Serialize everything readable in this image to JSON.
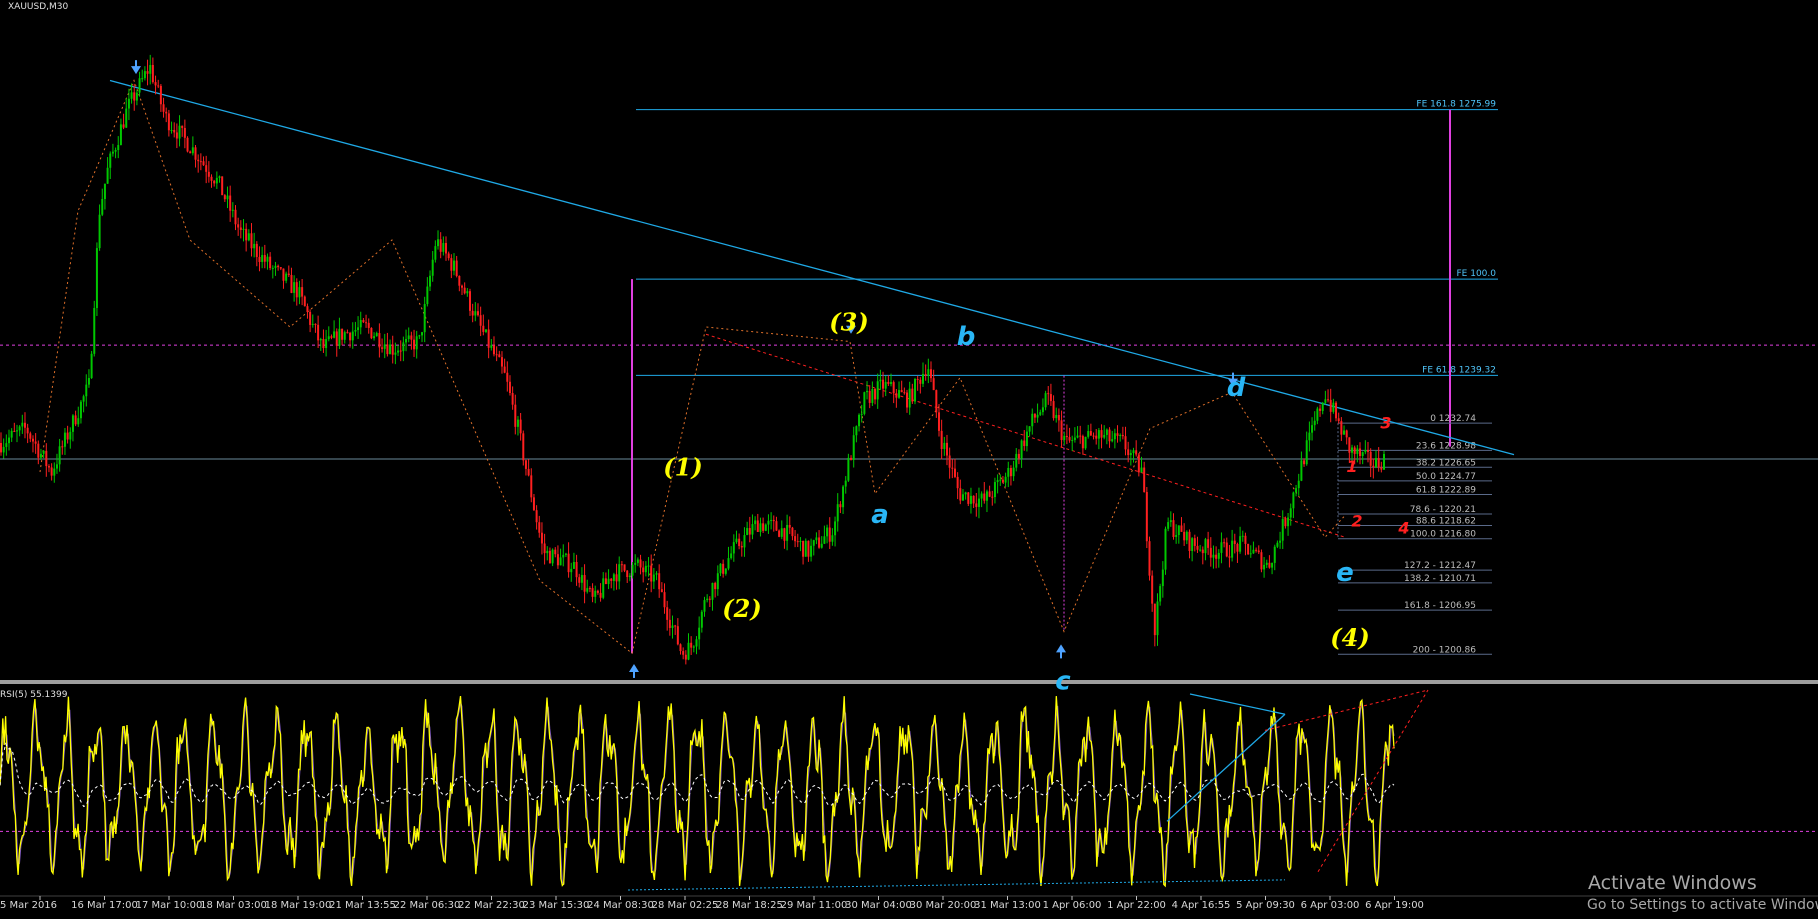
{
  "window": {
    "symbol_label": "XAUUSD,M30",
    "indicator_label": "RSI(5) 55.1399"
  },
  "watermark": {
    "line1": "Activate Windows",
    "line2": "Go to Settings to activate Windows."
  },
  "colors": {
    "background": "#000000",
    "candle_up": "#00c800",
    "candle_down": "#ff2020",
    "trendline": "#1fa9e6",
    "fib_expansion": "#1fa9e6",
    "magenta": "#e040e0",
    "wave_yellow": "#ffff00",
    "wave_blue": "#29b6f6",
    "wave_red": "#ff2020",
    "rsi_main": "#ffff00",
    "rsi_secondary": "#7e57c2",
    "zigzag": "#e0702a"
  },
  "chart_data": [
    {
      "type": "candlestick",
      "title": "",
      "instrument": "XAUUSD",
      "timeframe": "M30",
      "ylim": [
        1198,
        1290
      ],
      "x_tick_labels": [
        "5 Mar 2016",
        "16 Mar 17:00",
        "17 Mar 10:00",
        "18 Mar 03:00",
        "18 Mar 19:00",
        "21 Mar 13:55",
        "22 Mar 06:30",
        "22 Mar 22:30",
        "23 Mar 15:30",
        "24 Mar 08:30",
        "28 Mar 02:25",
        "28 Mar 18:25",
        "29 Mar 11:00",
        "30 Mar 04:00",
        "30 Mar 20:00",
        "31 Mar 13:00",
        "1 Apr 06:00",
        "1 Apr 22:00",
        "4 Apr 16:55",
        "5 Apr 09:30",
        "6 Apr 03:00",
        "6 Apr 19:00"
      ],
      "price_path": {
        "x": [
          0,
          20,
          40,
          70,
          78,
          85,
          100,
          118,
          130,
          150,
          172,
          190,
          215,
          235,
          255,
          270,
          290,
          310,
          332,
          345,
          360,
          380,
          400,
          410,
          430,
          455,
          470,
          485,
          505,
          520,
          540,
          548,
          560,
          580,
          600,
          620,
          640,
          660,
          672,
          685,
          700,
          720,
          735,
          745,
          760,
          780,
          800,
          818,
          830,
          845,
          870,
          890,
          905,
          915,
          925,
          945,
          965,
          985,
          1005,
          1020,
          1035,
          1050,
          1070,
          1090,
          1105,
          1120,
          1135,
          1143,
          1155,
          1170,
          1185,
          1195
        ],
        "y": [
          1230,
          1232,
          1226,
          1238,
          1262,
          1268,
          1276,
          1282,
          1275,
          1271,
          1266,
          1259,
          1254,
          1251,
          1243,
          1245,
          1246,
          1243,
          1244,
          1258,
          1254,
          1246,
          1239,
          1232,
          1215,
          1213,
          1208,
          1212,
          1213,
          1211,
          1201,
          1202,
          1209,
          1215,
          1219,
          1218,
          1215,
          1218,
          1227,
          1236,
          1238,
          1236,
          1241,
          1231,
          1223,
          1222,
          1226,
          1233,
          1236,
          1230,
          1231,
          1230,
          1226,
          1204,
          1219,
          1216,
          1215,
          1216,
          1213,
          1220,
          1229,
          1237,
          1229,
          1227,
          1229,
          1223,
          1219,
          1216,
          1219,
          1223,
          1228,
          1229
        ]
      },
      "horizontal_levels": [
        {
          "name": "FE 161.8",
          "value": 1275.99,
          "label": "FE 161.8 1275.99"
        },
        {
          "name": "FE 100.0",
          "value": 1252.6,
          "label": "FE 100.0"
        },
        {
          "name": "FE 61.8",
          "value": 1239.32,
          "label": "FE 61.8 1239.32"
        },
        {
          "name": "magenta-dotted",
          "value": 1243.5
        },
        {
          "name": "grey-solid",
          "value": 1227.8
        }
      ],
      "fibonacci_retracement": [
        {
          "level": "0",
          "price": 1232.74,
          "label": "0 1232.74"
        },
        {
          "level": "23.6",
          "price": 1228.98,
          "label": "23.6 1228.98"
        },
        {
          "level": "38.2",
          "price": 1226.65,
          "label": "38.2 1226.65"
        },
        {
          "level": "50.0",
          "price": 1224.77,
          "label": "50.0 1224.77"
        },
        {
          "level": "61.8",
          "price": 1222.89,
          "label": "61.8 1222.89"
        },
        {
          "level": "78.6",
          "price": 1220.21,
          "label": "78.6 - 1220.21"
        },
        {
          "level": "88.6",
          "price": 1218.62,
          "label": "88.6 1218.62"
        },
        {
          "level": "100.0",
          "price": 1216.8,
          "label": "100.0 1216.80"
        },
        {
          "level": "127.2",
          "price": 1212.47,
          "label": "127.2 - 1212.47"
        },
        {
          "level": "138.2",
          "price": 1210.71,
          "label": "138.2 - 1210.71"
        },
        {
          "level": "161.8",
          "price": 1206.95,
          "label": "161.8 - 1206.95"
        },
        {
          "level": "200",
          "price": 1200.86,
          "label": "200 - 1200.86"
        }
      ],
      "wave_labels": [
        {
          "text": "(1)",
          "color": "yellow"
        },
        {
          "text": "(2)",
          "color": "yellow"
        },
        {
          "text": "(3)",
          "color": "yellow"
        },
        {
          "text": "(4)",
          "color": "yellow"
        },
        {
          "text": "a",
          "color": "blue"
        },
        {
          "text": "b",
          "color": "blue"
        },
        {
          "text": "c",
          "color": "blue"
        },
        {
          "text": "d",
          "color": "blue"
        },
        {
          "text": "e",
          "color": "blue"
        },
        {
          "text": "1",
          "color": "red"
        },
        {
          "text": "2",
          "color": "red"
        },
        {
          "text": "3",
          "color": "red"
        },
        {
          "text": "4",
          "color": "red"
        }
      ]
    },
    {
      "type": "line",
      "title": "RSI(5) 55.1399",
      "indicator": "RSI",
      "period": 5,
      "last_value": 55.1399,
      "ylim": [
        0,
        100
      ],
      "levels": [
        30
      ],
      "x_tick_labels": []
    }
  ]
}
